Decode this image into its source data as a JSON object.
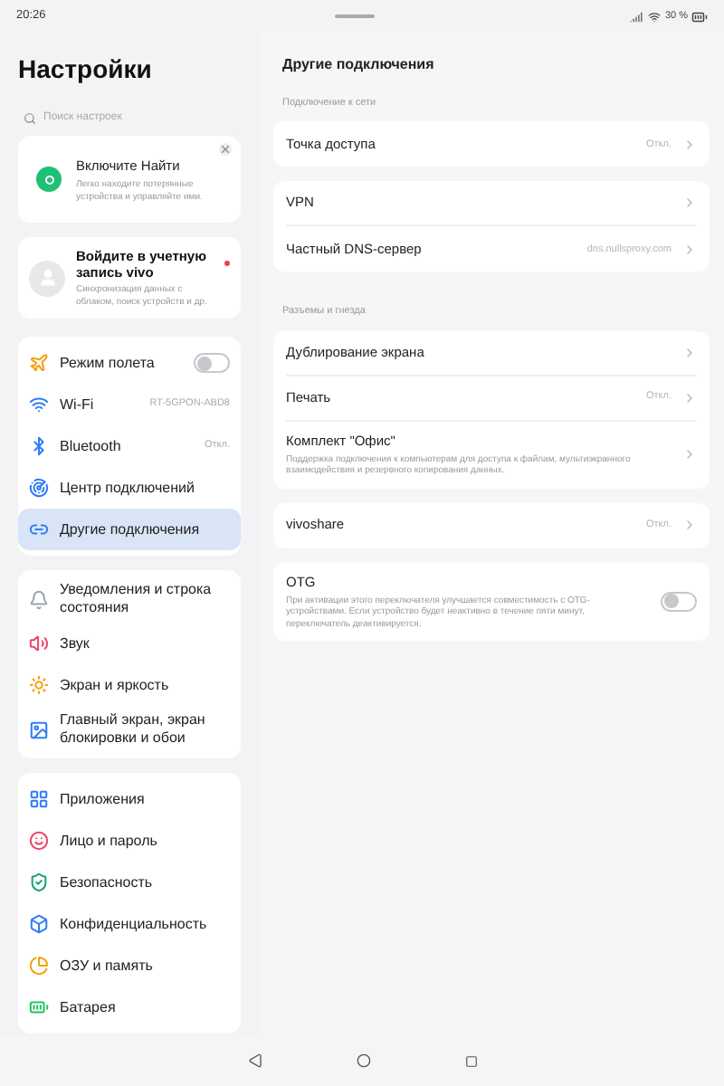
{
  "status_bar": {
    "time": "20:26",
    "battery": "30 %"
  },
  "sidebar": {
    "title": "Настройки",
    "search": {
      "placeholder": "Поиск настроек"
    },
    "find_card": {
      "title": "Включите Найти",
      "text": "Легко находите потерянные устройства и управляйте ими."
    },
    "account_card": {
      "title": "Войдите в учетную запись vivo",
      "text": "Синхронизация данных с облаком, поиск устройств и др.",
      "unread": true
    },
    "groups": [
      [
        {
          "label": "Режим полета",
          "kind": "toggle",
          "on": false,
          "selected": false
        },
        {
          "label": "Wi-Fi",
          "kind": "value",
          "value": "RT-5GPON-ABD8",
          "selected": false
        },
        {
          "label": "Bluetooth",
          "kind": "value",
          "value": "Откл.",
          "selected": false
        },
        {
          "label": "Центр подключений",
          "kind": "plain",
          "selected": false
        },
        {
          "label": "Другие подключения",
          "kind": "plain",
          "selected": true
        }
      ],
      [
        {
          "label": "Уведомления и строка состояния",
          "kind": "plain",
          "selected": false
        },
        {
          "label": "Звук",
          "kind": "plain",
          "selected": false
        },
        {
          "label": "Экран и яркость",
          "kind": "plain",
          "selected": false
        },
        {
          "label": "Главный экран, экран блокировки и обои",
          "kind": "plain",
          "selected": false
        }
      ],
      [
        {
          "label": "Приложения",
          "kind": "plain",
          "selected": false
        },
        {
          "label": "Лицо и пароль",
          "kind": "plain",
          "selected": false
        },
        {
          "label": "Безопасность",
          "kind": "plain",
          "selected": false
        },
        {
          "label": "Конфиденциальность",
          "kind": "plain",
          "selected": false
        },
        {
          "label": "ОЗУ и память",
          "kind": "plain",
          "selected": false
        },
        {
          "label": "Батарея",
          "kind": "plain",
          "selected": false
        }
      ]
    ]
  },
  "page": {
    "title": "Другие подключения",
    "sections": [
      {
        "label": "Подключение к сети",
        "groups": [
          [
            {
              "title": "Точка доступа",
              "kind": "link",
              "value": "Откл."
            }
          ],
          [
            {
              "title": "VPN",
              "kind": "link"
            },
            {
              "title": "Частный DNS-сервер",
              "kind": "link",
              "value": "dns.nullsproxy.com"
            }
          ]
        ]
      },
      {
        "label": "Разъемы и гнезда",
        "groups": [
          [
            {
              "title": "Дублирование экрана",
              "kind": "link"
            },
            {
              "title": "Печать",
              "kind": "link",
              "value": "Откл."
            },
            {
              "title": "Комплект \"Офис\"",
              "kind": "link",
              "subtitle": "Поддержка подключения к компьютерам для доступа к файлам, мультиэкранного взаимодействия и резервного копирования данных."
            }
          ],
          [
            {
              "title": "vivoshare",
              "kind": "link",
              "value": "Откл."
            }
          ],
          [
            {
              "title": "OTG",
              "kind": "toggle",
              "on": false,
              "subtitle": "При активации этого переключателя улучшается совместимость с OTG-устройствами. Если устройство будет неактивно в течение пяти минут, переключатель деактивируется."
            }
          ]
        ]
      }
    ]
  }
}
